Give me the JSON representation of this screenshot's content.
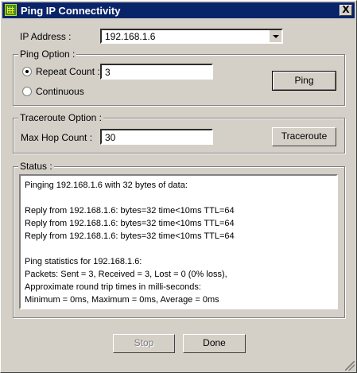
{
  "window": {
    "title": "Ping IP Connectivity",
    "close_glyph": "X"
  },
  "ip_address": {
    "label": "IP Address :",
    "value": "192.168.1.6"
  },
  "ping_option": {
    "title": "Ping Option :",
    "repeat_label": "Repeat Count :",
    "repeat_value": "3",
    "continuous_label": "Continuous",
    "selected": "repeat",
    "ping_button": "Ping"
  },
  "traceroute_option": {
    "title": "Traceroute Option :",
    "max_hop_label": "Max Hop Count :",
    "max_hop_value": "30",
    "traceroute_button": "Traceroute"
  },
  "status": {
    "title": "Status :",
    "lines": [
      "Pinging 192.168.1.6 with 32 bytes of data:",
      "",
      "Reply from 192.168.1.6: bytes=32 time<10ms TTL=64",
      "Reply from 192.168.1.6: bytes=32 time<10ms TTL=64",
      "Reply from 192.168.1.6: bytes=32 time<10ms TTL=64",
      "",
      "Ping statistics for 192.168.1.6:",
      "Packets: Sent = 3, Received = 3, Lost = 0 (0% loss),",
      "Approximate round trip times in milli-seconds:",
      "Minimum = 0ms, Maximum =  0ms, Average =  0ms"
    ]
  },
  "footer": {
    "stop_button": "Stop",
    "stop_enabled": false,
    "done_button": "Done"
  },
  "colors": {
    "titlebar": "#0a246a",
    "face": "#d4d0c8"
  }
}
